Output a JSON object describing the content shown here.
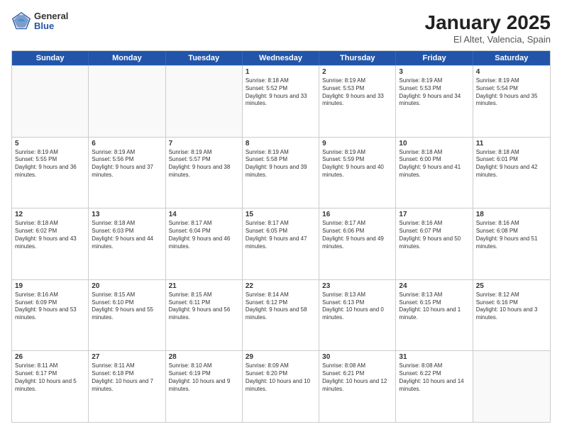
{
  "header": {
    "logo_general": "General",
    "logo_blue": "Blue",
    "month_year": "January 2025",
    "location": "El Altet, Valencia, Spain"
  },
  "weekdays": [
    "Sunday",
    "Monday",
    "Tuesday",
    "Wednesday",
    "Thursday",
    "Friday",
    "Saturday"
  ],
  "rows": [
    [
      {
        "day": "",
        "sunrise": "",
        "sunset": "",
        "daylight": ""
      },
      {
        "day": "",
        "sunrise": "",
        "sunset": "",
        "daylight": ""
      },
      {
        "day": "",
        "sunrise": "",
        "sunset": "",
        "daylight": ""
      },
      {
        "day": "1",
        "sunrise": "Sunrise: 8:18 AM",
        "sunset": "Sunset: 5:52 PM",
        "daylight": "Daylight: 9 hours and 33 minutes."
      },
      {
        "day": "2",
        "sunrise": "Sunrise: 8:19 AM",
        "sunset": "Sunset: 5:53 PM",
        "daylight": "Daylight: 9 hours and 33 minutes."
      },
      {
        "day": "3",
        "sunrise": "Sunrise: 8:19 AM",
        "sunset": "Sunset: 5:53 PM",
        "daylight": "Daylight: 9 hours and 34 minutes."
      },
      {
        "day": "4",
        "sunrise": "Sunrise: 8:19 AM",
        "sunset": "Sunset: 5:54 PM",
        "daylight": "Daylight: 9 hours and 35 minutes."
      }
    ],
    [
      {
        "day": "5",
        "sunrise": "Sunrise: 8:19 AM",
        "sunset": "Sunset: 5:55 PM",
        "daylight": "Daylight: 9 hours and 36 minutes."
      },
      {
        "day": "6",
        "sunrise": "Sunrise: 8:19 AM",
        "sunset": "Sunset: 5:56 PM",
        "daylight": "Daylight: 9 hours and 37 minutes."
      },
      {
        "day": "7",
        "sunrise": "Sunrise: 8:19 AM",
        "sunset": "Sunset: 5:57 PM",
        "daylight": "Daylight: 9 hours and 38 minutes."
      },
      {
        "day": "8",
        "sunrise": "Sunrise: 8:19 AM",
        "sunset": "Sunset: 5:58 PM",
        "daylight": "Daylight: 9 hours and 39 minutes."
      },
      {
        "day": "9",
        "sunrise": "Sunrise: 8:19 AM",
        "sunset": "Sunset: 5:59 PM",
        "daylight": "Daylight: 9 hours and 40 minutes."
      },
      {
        "day": "10",
        "sunrise": "Sunrise: 8:18 AM",
        "sunset": "Sunset: 6:00 PM",
        "daylight": "Daylight: 9 hours and 41 minutes."
      },
      {
        "day": "11",
        "sunrise": "Sunrise: 8:18 AM",
        "sunset": "Sunset: 6:01 PM",
        "daylight": "Daylight: 9 hours and 42 minutes."
      }
    ],
    [
      {
        "day": "12",
        "sunrise": "Sunrise: 8:18 AM",
        "sunset": "Sunset: 6:02 PM",
        "daylight": "Daylight: 9 hours and 43 minutes."
      },
      {
        "day": "13",
        "sunrise": "Sunrise: 8:18 AM",
        "sunset": "Sunset: 6:03 PM",
        "daylight": "Daylight: 9 hours and 44 minutes."
      },
      {
        "day": "14",
        "sunrise": "Sunrise: 8:17 AM",
        "sunset": "Sunset: 6:04 PM",
        "daylight": "Daylight: 9 hours and 46 minutes."
      },
      {
        "day": "15",
        "sunrise": "Sunrise: 8:17 AM",
        "sunset": "Sunset: 6:05 PM",
        "daylight": "Daylight: 9 hours and 47 minutes."
      },
      {
        "day": "16",
        "sunrise": "Sunrise: 8:17 AM",
        "sunset": "Sunset: 6:06 PM",
        "daylight": "Daylight: 9 hours and 49 minutes."
      },
      {
        "day": "17",
        "sunrise": "Sunrise: 8:16 AM",
        "sunset": "Sunset: 6:07 PM",
        "daylight": "Daylight: 9 hours and 50 minutes."
      },
      {
        "day": "18",
        "sunrise": "Sunrise: 8:16 AM",
        "sunset": "Sunset: 6:08 PM",
        "daylight": "Daylight: 9 hours and 51 minutes."
      }
    ],
    [
      {
        "day": "19",
        "sunrise": "Sunrise: 8:16 AM",
        "sunset": "Sunset: 6:09 PM",
        "daylight": "Daylight: 9 hours and 53 minutes."
      },
      {
        "day": "20",
        "sunrise": "Sunrise: 8:15 AM",
        "sunset": "Sunset: 6:10 PM",
        "daylight": "Daylight: 9 hours and 55 minutes."
      },
      {
        "day": "21",
        "sunrise": "Sunrise: 8:15 AM",
        "sunset": "Sunset: 6:11 PM",
        "daylight": "Daylight: 9 hours and 56 minutes."
      },
      {
        "day": "22",
        "sunrise": "Sunrise: 8:14 AM",
        "sunset": "Sunset: 6:12 PM",
        "daylight": "Daylight: 9 hours and 58 minutes."
      },
      {
        "day": "23",
        "sunrise": "Sunrise: 8:13 AM",
        "sunset": "Sunset: 6:13 PM",
        "daylight": "Daylight: 10 hours and 0 minutes."
      },
      {
        "day": "24",
        "sunrise": "Sunrise: 8:13 AM",
        "sunset": "Sunset: 6:15 PM",
        "daylight": "Daylight: 10 hours and 1 minute."
      },
      {
        "day": "25",
        "sunrise": "Sunrise: 8:12 AM",
        "sunset": "Sunset: 6:16 PM",
        "daylight": "Daylight: 10 hours and 3 minutes."
      }
    ],
    [
      {
        "day": "26",
        "sunrise": "Sunrise: 8:11 AM",
        "sunset": "Sunset: 6:17 PM",
        "daylight": "Daylight: 10 hours and 5 minutes."
      },
      {
        "day": "27",
        "sunrise": "Sunrise: 8:11 AM",
        "sunset": "Sunset: 6:18 PM",
        "daylight": "Daylight: 10 hours and 7 minutes."
      },
      {
        "day": "28",
        "sunrise": "Sunrise: 8:10 AM",
        "sunset": "Sunset: 6:19 PM",
        "daylight": "Daylight: 10 hours and 9 minutes."
      },
      {
        "day": "29",
        "sunrise": "Sunrise: 8:09 AM",
        "sunset": "Sunset: 6:20 PM",
        "daylight": "Daylight: 10 hours and 10 minutes."
      },
      {
        "day": "30",
        "sunrise": "Sunrise: 8:08 AM",
        "sunset": "Sunset: 6:21 PM",
        "daylight": "Daylight: 10 hours and 12 minutes."
      },
      {
        "day": "31",
        "sunrise": "Sunrise: 8:08 AM",
        "sunset": "Sunset: 6:22 PM",
        "daylight": "Daylight: 10 hours and 14 minutes."
      },
      {
        "day": "",
        "sunrise": "",
        "sunset": "",
        "daylight": ""
      }
    ]
  ]
}
